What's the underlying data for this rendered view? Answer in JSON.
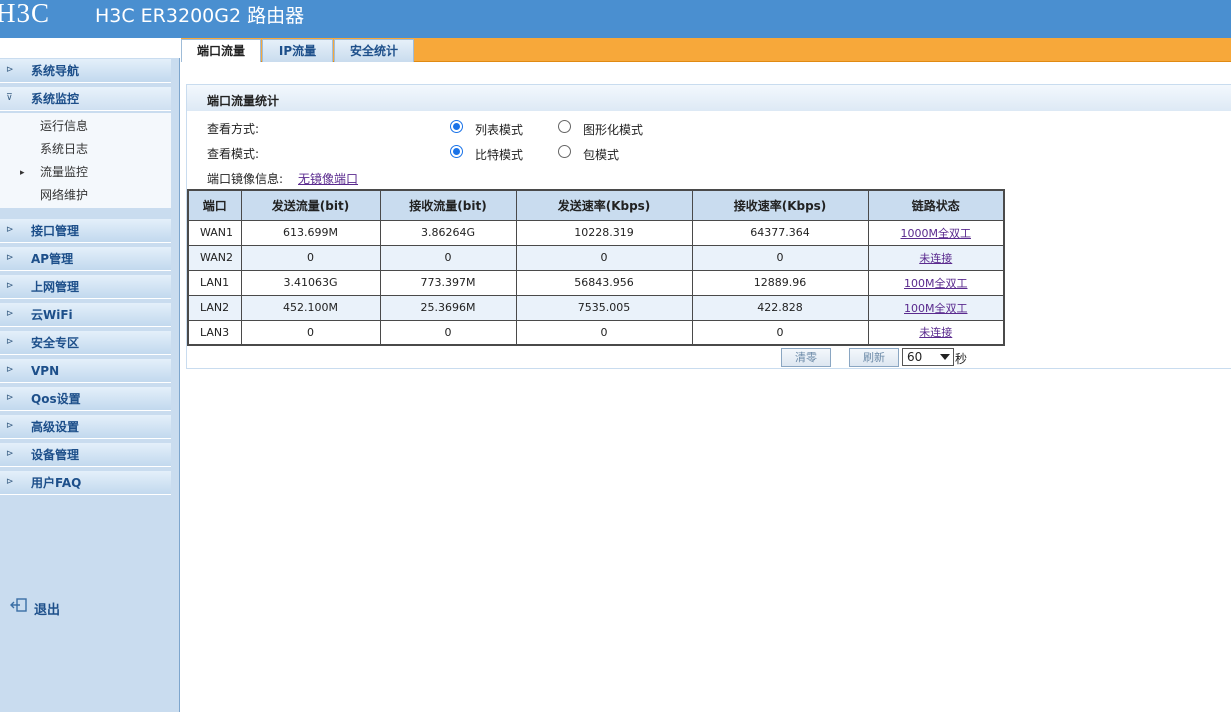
{
  "header": {
    "logo": "H3C",
    "title": "H3C ER3200G2 路由器"
  },
  "tabs": [
    {
      "label": "端口流量",
      "active": true
    },
    {
      "label": "IP流量",
      "active": false
    },
    {
      "label": "安全统计",
      "active": false
    }
  ],
  "sidebar": {
    "items": [
      {
        "label": "系统导航"
      },
      {
        "label": "系统监控",
        "open": true
      },
      {
        "label": "接口管理"
      },
      {
        "label": "AP管理"
      },
      {
        "label": "上网管理"
      },
      {
        "label": "云WiFi"
      },
      {
        "label": "安全专区"
      },
      {
        "label": "VPN"
      },
      {
        "label": "Qos设置"
      },
      {
        "label": "高级设置"
      },
      {
        "label": "设备管理"
      },
      {
        "label": "用户FAQ"
      }
    ],
    "subitems": [
      {
        "label": "运行信息"
      },
      {
        "label": "系统日志"
      },
      {
        "label": "流量监控",
        "active": true
      },
      {
        "label": "网络维护"
      }
    ],
    "logout": "退出"
  },
  "panel": {
    "title": "端口流量统计",
    "view_mode_label": "查看方式:",
    "view_options": [
      "列表模式",
      "图形化模式"
    ],
    "view_selected": "列表模式",
    "unit_mode_label": "查看模式:",
    "unit_options": [
      "比特模式",
      "包模式"
    ],
    "unit_selected": "比特模式",
    "mirror_label": "端口镜像信息:",
    "mirror_link": "无镜像端口"
  },
  "table": {
    "headers": [
      "端口",
      "发送流量(bit)",
      "接收流量(bit)",
      "发送速率(Kbps)",
      "接收速率(Kbps)",
      "链路状态"
    ],
    "rows": [
      [
        "WAN1",
        "613.699M",
        "3.86264G",
        "10228.319",
        "64377.364",
        "1000M全双工"
      ],
      [
        "WAN2",
        "0",
        "0",
        "0",
        "0",
        "未连接"
      ],
      [
        "LAN1",
        "3.41063G",
        "773.397M",
        "56843.956",
        "12889.96",
        "100M全双工"
      ],
      [
        "LAN2",
        "452.100M",
        "25.3696M",
        "7535.005",
        "422.828",
        "100M全双工"
      ],
      [
        "LAN3",
        "0",
        "0",
        "0",
        "0",
        "未连接"
      ]
    ]
  },
  "controls": {
    "clear_button": "清零",
    "refresh_button": "刷新",
    "interval_value": "60",
    "interval_unit": "秒"
  },
  "colors": {
    "header_bg": "#4a8fd0",
    "tabbar_bg": "#f7a83a",
    "sidebar_bg": "#c9dcef",
    "table_header_bg": "#c9dcef",
    "link": "#5a2a8e"
  }
}
